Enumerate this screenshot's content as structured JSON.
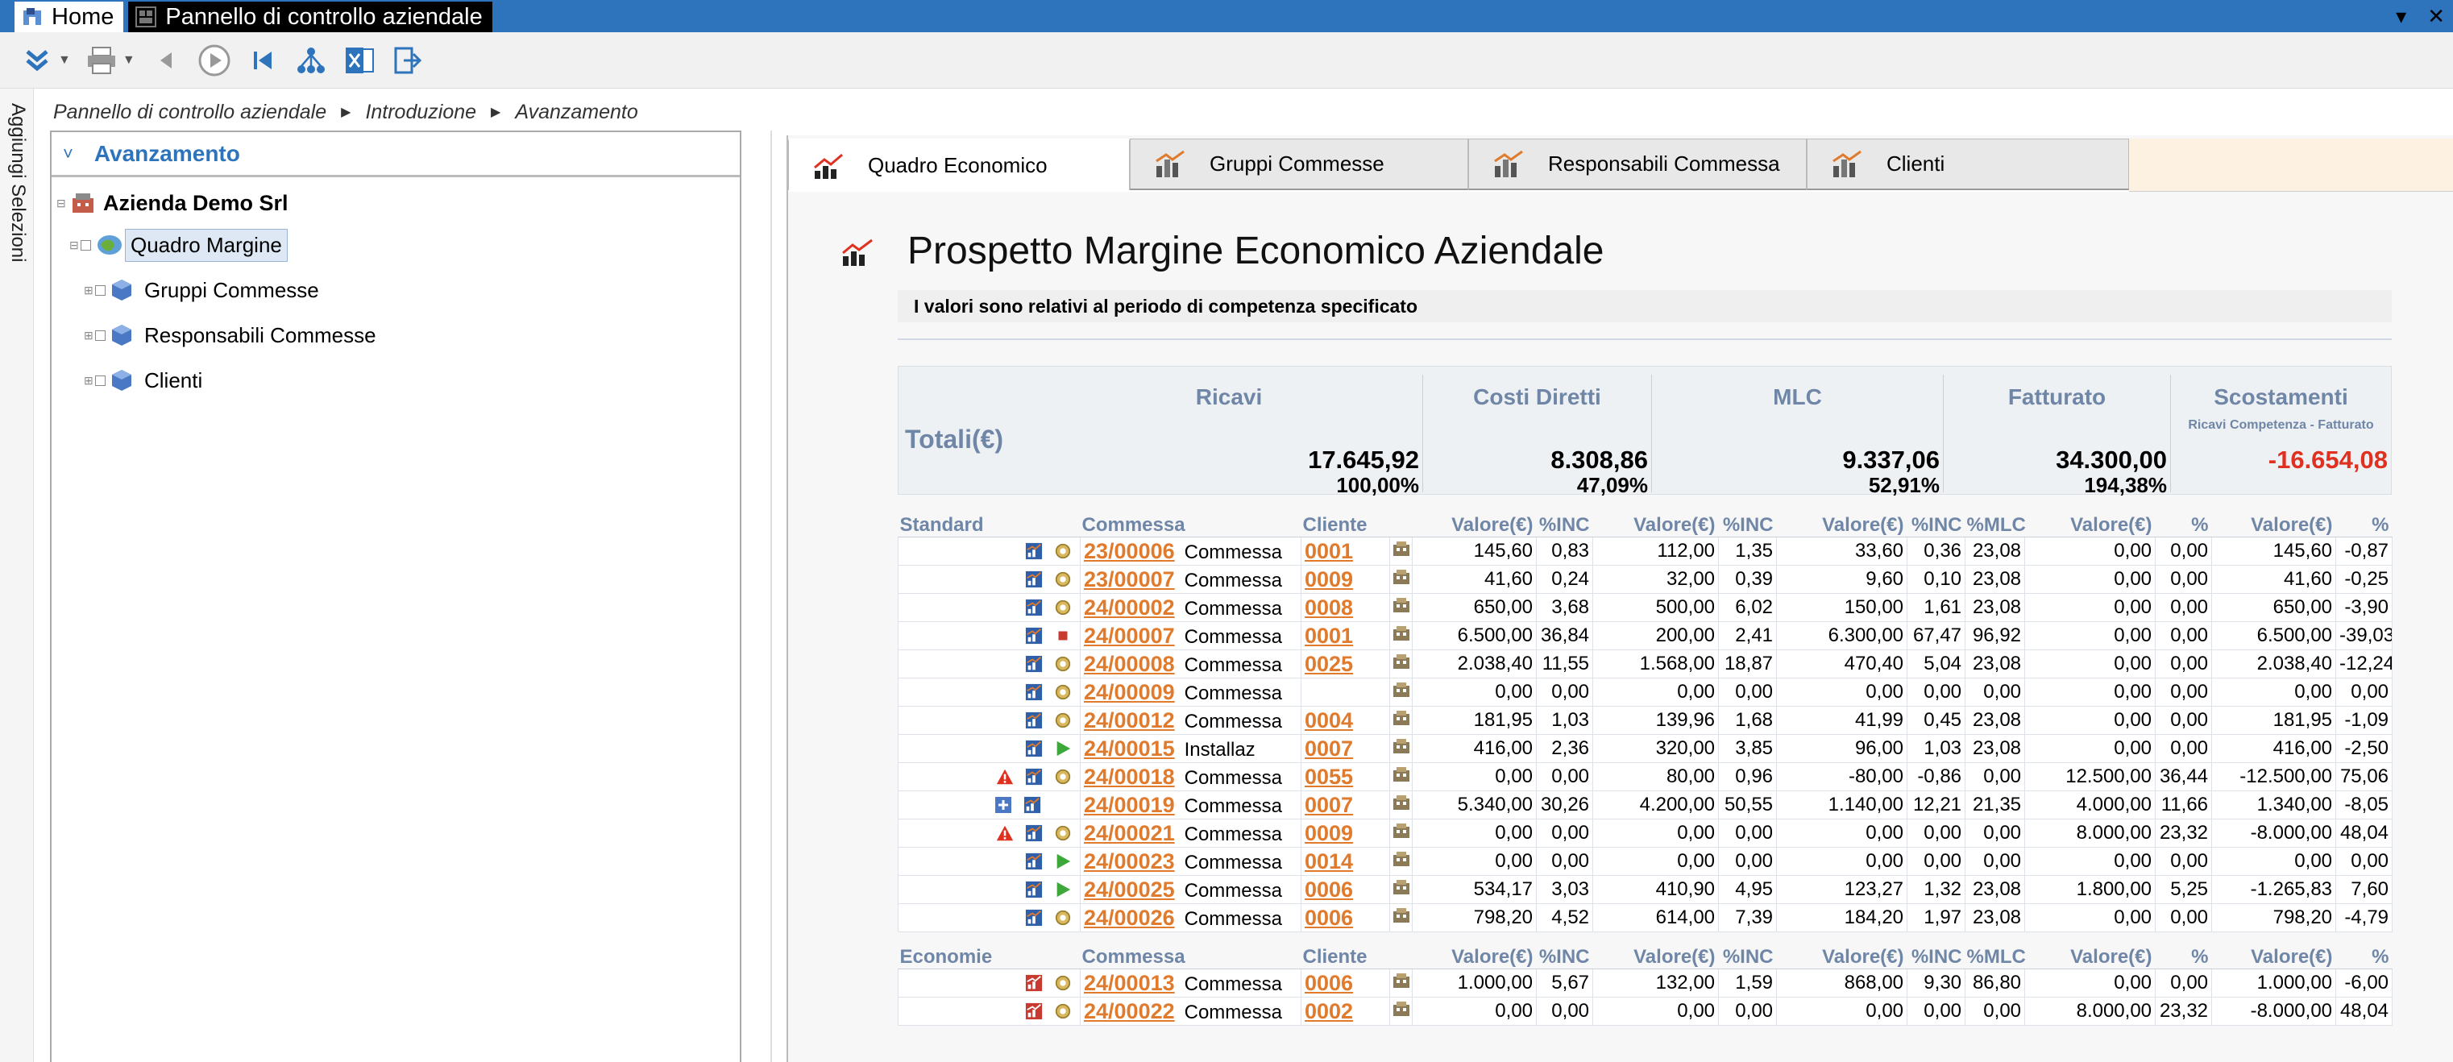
{
  "window": {
    "tabs": [
      {
        "label": "Home"
      },
      {
        "label": "Pannello di controllo aziendale"
      }
    ]
  },
  "toolbar": {
    "icons": [
      "expand-icon",
      "print-icon",
      "back-icon",
      "play-icon",
      "first-icon",
      "hierarchy-icon",
      "excel-icon",
      "exit-icon"
    ]
  },
  "vstrip": {
    "label": "Aggiungi Selezioni"
  },
  "breadcrumb": [
    "Pannello di controllo aziendale",
    "Introduzione",
    "Avanzamento"
  ],
  "left": {
    "header": "Avanzamento",
    "tree": [
      {
        "label": "Azienda Demo Srl"
      },
      {
        "label": "Quadro Margine"
      },
      {
        "label": "Gruppi Commesse"
      },
      {
        "label": "Responsabili Commesse"
      },
      {
        "label": "Clienti"
      }
    ]
  },
  "tabs": [
    {
      "label": "Quadro Economico"
    },
    {
      "label": "Gruppi Commesse"
    },
    {
      "label": "Responsabili Commessa"
    },
    {
      "label": "Clienti"
    }
  ],
  "report": {
    "title": "Prospetto Margine Economico Aziendale",
    "note": "I valori sono relativi al periodo di competenza specificato",
    "totals_label": "Totali(€)",
    "totals": [
      {
        "head": "Ricavi",
        "sub": "",
        "value": "17.645,92",
        "pct": "100,00%"
      },
      {
        "head": "Costi Diretti",
        "sub": "",
        "value": "8.308,86",
        "pct": "47,09%"
      },
      {
        "head": "MLC",
        "sub": "",
        "value": "9.337,06",
        "pct": "52,91%"
      },
      {
        "head": "Fatturato",
        "sub": "",
        "value": "34.300,00",
        "pct": "194,38%"
      },
      {
        "head": "Scostamenti",
        "sub": "Ricavi Competenza - Fatturato",
        "value": "-16.654,08",
        "pct": ""
      }
    ],
    "columns": [
      "Commessa",
      "Cliente",
      "Valore(€)",
      "%INC",
      "Valore(€)",
      "%INC",
      "Valore(€)",
      "%INC",
      "%MLC",
      "Valore(€)",
      "%",
      "Valore(€)",
      "%"
    ],
    "standard_label": "Standard",
    "standard_rows": [
      {
        "warn": false,
        "expand": false,
        "status": "gear",
        "code": "23/00006",
        "desc": "Commessa",
        "client": "0001",
        "v": [
          "145,60",
          "0,83",
          "112,00",
          "1,35",
          "33,60",
          "0,36",
          "23,08",
          "0,00",
          "0,00",
          "145,60",
          "-0,87"
        ]
      },
      {
        "warn": false,
        "expand": false,
        "status": "gear",
        "code": "23/00007",
        "desc": "Commessa",
        "client": "0009",
        "v": [
          "41,60",
          "0,24",
          "32,00",
          "0,39",
          "9,60",
          "0,10",
          "23,08",
          "0,00",
          "0,00",
          "41,60",
          "-0,25"
        ]
      },
      {
        "warn": false,
        "expand": false,
        "status": "gear",
        "code": "24/00002",
        "desc": "Commessa",
        "client": "0008",
        "v": [
          "650,00",
          "3,68",
          "500,00",
          "6,02",
          "150,00",
          "1,61",
          "23,08",
          "0,00",
          "0,00",
          "650,00",
          "-3,90"
        ]
      },
      {
        "warn": false,
        "expand": false,
        "status": "stop",
        "code": "24/00007",
        "desc": "Commessa",
        "client": "0001",
        "v": [
          "6.500,00",
          "36,84",
          "200,00",
          "2,41",
          "6.300,00",
          "67,47",
          "96,92",
          "0,00",
          "0,00",
          "6.500,00",
          "-39,03"
        ]
      },
      {
        "warn": false,
        "expand": false,
        "status": "gear",
        "code": "24/00008",
        "desc": "Commessa",
        "client": "0025",
        "v": [
          "2.038,40",
          "11,55",
          "1.568,00",
          "18,87",
          "470,40",
          "5,04",
          "23,08",
          "0,00",
          "0,00",
          "2.038,40",
          "-12,24"
        ]
      },
      {
        "warn": false,
        "expand": false,
        "status": "gear",
        "code": "24/00009",
        "desc": "Commessa",
        "client": "",
        "v": [
          "0,00",
          "0,00",
          "0,00",
          "0,00",
          "0,00",
          "0,00",
          "0,00",
          "0,00",
          "0,00",
          "0,00",
          "0,00"
        ]
      },
      {
        "warn": false,
        "expand": false,
        "status": "gear",
        "code": "24/00012",
        "desc": "Commessa",
        "client": "0004",
        "v": [
          "181,95",
          "1,03",
          "139,96",
          "1,68",
          "41,99",
          "0,45",
          "23,08",
          "0,00",
          "0,00",
          "181,95",
          "-1,09"
        ]
      },
      {
        "warn": false,
        "expand": false,
        "status": "play",
        "code": "24/00015",
        "desc": "Installaz",
        "client": "0007",
        "v": [
          "416,00",
          "2,36",
          "320,00",
          "3,85",
          "96,00",
          "1,03",
          "23,08",
          "0,00",
          "0,00",
          "416,00",
          "-2,50"
        ]
      },
      {
        "warn": true,
        "expand": false,
        "status": "gear",
        "code": "24/00018",
        "desc": "Commessa",
        "client": "0055",
        "v": [
          "0,00",
          "0,00",
          "80,00",
          "0,96",
          "-80,00",
          "-0,86",
          "0,00",
          "12.500,00",
          "36,44",
          "-12.500,00",
          "75,06"
        ]
      },
      {
        "warn": false,
        "expand": true,
        "status": "none",
        "code": "24/00019",
        "desc": "Commessa",
        "client": "0007",
        "v": [
          "5.340,00",
          "30,26",
          "4.200,00",
          "50,55",
          "1.140,00",
          "12,21",
          "21,35",
          "4.000,00",
          "11,66",
          "1.340,00",
          "-8,05"
        ]
      },
      {
        "warn": true,
        "expand": false,
        "status": "gear",
        "code": "24/00021",
        "desc": "Commessa",
        "client": "0009",
        "v": [
          "0,00",
          "0,00",
          "0,00",
          "0,00",
          "0,00",
          "0,00",
          "0,00",
          "8.000,00",
          "23,32",
          "-8.000,00",
          "48,04"
        ]
      },
      {
        "warn": false,
        "expand": false,
        "status": "play",
        "code": "24/00023",
        "desc": "Commessa",
        "client": "0014",
        "v": [
          "0,00",
          "0,00",
          "0,00",
          "0,00",
          "0,00",
          "0,00",
          "0,00",
          "0,00",
          "0,00",
          "0,00",
          "0,00"
        ]
      },
      {
        "warn": false,
        "expand": false,
        "status": "play",
        "code": "24/00025",
        "desc": "Commessa",
        "client": "0006",
        "v": [
          "534,17",
          "3,03",
          "410,90",
          "4,95",
          "123,27",
          "1,32",
          "23,08",
          "1.800,00",
          "5,25",
          "-1.265,83",
          "7,60"
        ]
      },
      {
        "warn": false,
        "expand": false,
        "status": "gear",
        "code": "24/00026",
        "desc": "Commessa",
        "client": "0006",
        "v": [
          "798,20",
          "4,52",
          "614,00",
          "7,39",
          "184,20",
          "1,97",
          "23,08",
          "0,00",
          "0,00",
          "798,20",
          "-4,79"
        ]
      }
    ],
    "economie_label": "Economie",
    "economie_rows": [
      {
        "warn": false,
        "expand": false,
        "status": "gear",
        "code": "24/00013",
        "desc": "Commessa",
        "client": "0006",
        "v": [
          "1.000,00",
          "5,67",
          "132,00",
          "1,59",
          "868,00",
          "9,30",
          "86,80",
          "0,00",
          "0,00",
          "1.000,00",
          "-6,00"
        ]
      },
      {
        "warn": false,
        "expand": false,
        "status": "gear",
        "code": "24/00022",
        "desc": "Commessa",
        "client": "0002",
        "v": [
          "0,00",
          "0,00",
          "0,00",
          "0,00",
          "0,00",
          "0,00",
          "0,00",
          "8.000,00",
          "23,32",
          "-8.000,00",
          "48,04"
        ]
      }
    ]
  }
}
